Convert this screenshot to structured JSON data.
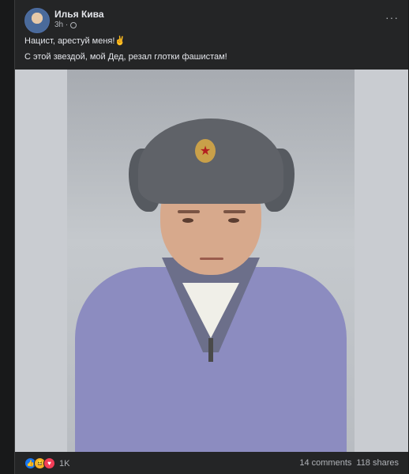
{
  "post": {
    "author": "Илья Кива",
    "time": "3h ·",
    "more_label": "···",
    "line1": "Нацист, арестуй меня!✌",
    "line2": "С этой звездой,  мой Дед, резал глотки фашистам!",
    "badge_symbol": "★"
  },
  "footer": {
    "reaction_icons": [
      "like-icon",
      "haha-icon",
      "love-icon"
    ],
    "reaction_glyphs": {
      "like": "👍",
      "haha": "😆",
      "love": "♥"
    },
    "reaction_count": "1K",
    "comments": "14 comments",
    "shares": "118 shares"
  },
  "colors": {
    "background": "#242526",
    "text": "#e4e6eb",
    "muted": "#b0b3b8"
  }
}
